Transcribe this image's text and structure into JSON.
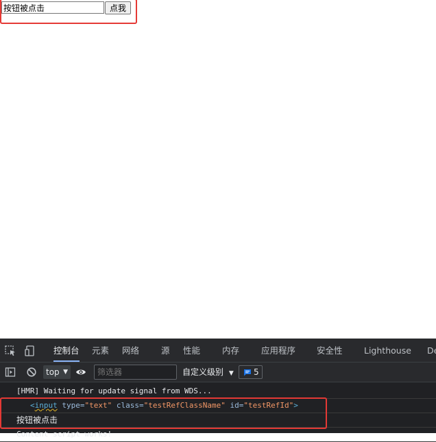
{
  "page": {
    "input_value": "按钮被点击",
    "button_label": "点我"
  },
  "devtools": {
    "tabs": [
      {
        "label": "控制台",
        "active": true
      },
      {
        "label": "元素"
      },
      {
        "label": "网络"
      },
      {
        "label": "源"
      },
      {
        "label": "性能"
      },
      {
        "label": "内存"
      },
      {
        "label": "应用程序"
      },
      {
        "label": "安全性"
      },
      {
        "label": "Lighthouse"
      },
      {
        "label": "De"
      }
    ],
    "toolbar": {
      "context": "top",
      "filter_placeholder": "筛选器",
      "levels": "自定义级别",
      "message_count": "5"
    },
    "console": {
      "line1": "[HMR] Waiting for update signal from WDS...",
      "el_tag_open": "<",
      "el_tag_name": "input",
      "el_attr_type": "type",
      "el_val_type": "\"text\"",
      "el_attr_class": "class",
      "el_val_class": "\"testRefClassName\"",
      "el_attr_id": "id",
      "el_val_id": "\"testRefId\"",
      "el_tag_close": ">",
      "line3": "按钮被点击",
      "line4": "Content script works!"
    }
  },
  "colors": {
    "highlight": "#e53935",
    "devtools_bg": "#202124",
    "active_tab_underline": "#8ab4f8"
  }
}
